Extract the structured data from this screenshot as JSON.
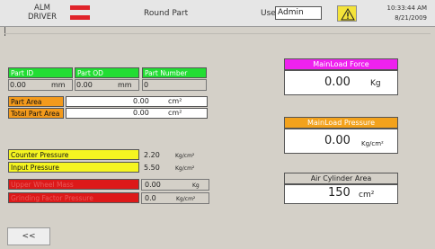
{
  "header": {
    "alm_line1": "ALM",
    "alm_line2": "DRIVER",
    "alarm_icon": "alarm-stripes-icon",
    "title": "Round Part",
    "user_label": "User",
    "user_value": "Admin",
    "warning_icon": "warning-triangle-icon",
    "time": "10:33:44 AM",
    "date": "8/21/2009"
  },
  "part": {
    "id_label": "Part ID",
    "od_label": "Part OD",
    "number_label": "Part Number",
    "id_value": "0.00",
    "id_unit": "mm",
    "od_value": "0.00",
    "od_unit": "mm",
    "number_value": "0",
    "area_label": "Part Area",
    "area_value": "0.00",
    "area_unit": "cm²",
    "total_area_label": "Total Part Area",
    "total_area_value": "0.00",
    "total_area_unit": "cm²"
  },
  "pressures": {
    "counter_label": "Counter Pressure",
    "counter_value": "2.20",
    "counter_unit": "Kg/cm²",
    "input_label": "Input Pressure",
    "input_value": "5.50",
    "input_unit": "Kg/cm²",
    "wheel_label": "Upper Wheel Mass",
    "wheel_value": "0.00",
    "wheel_unit": "Kg",
    "grinding_label": "Grinding Factor Pressure",
    "grinding_value": "0.0",
    "grinding_unit": "Kg/cm²"
  },
  "right": {
    "force_label": "MainLoad Force",
    "force_value": "0.00",
    "force_unit": "Kg",
    "pressure_label": "MainLoad Pressure",
    "pressure_value": "0.00",
    "pressure_unit": "Kg/cm²",
    "cyl_label": "Air Cylinder Area",
    "cyl_value": "150",
    "cyl_unit": "cm²"
  },
  "nav": {
    "back_label": "<<"
  },
  "colors": {
    "green": "#22dd33",
    "orange": "#f39a1c",
    "yellow": "#f5f521",
    "red": "#dd1919",
    "magenta": "#ee22ee",
    "alarm_red": "#e0242a"
  }
}
